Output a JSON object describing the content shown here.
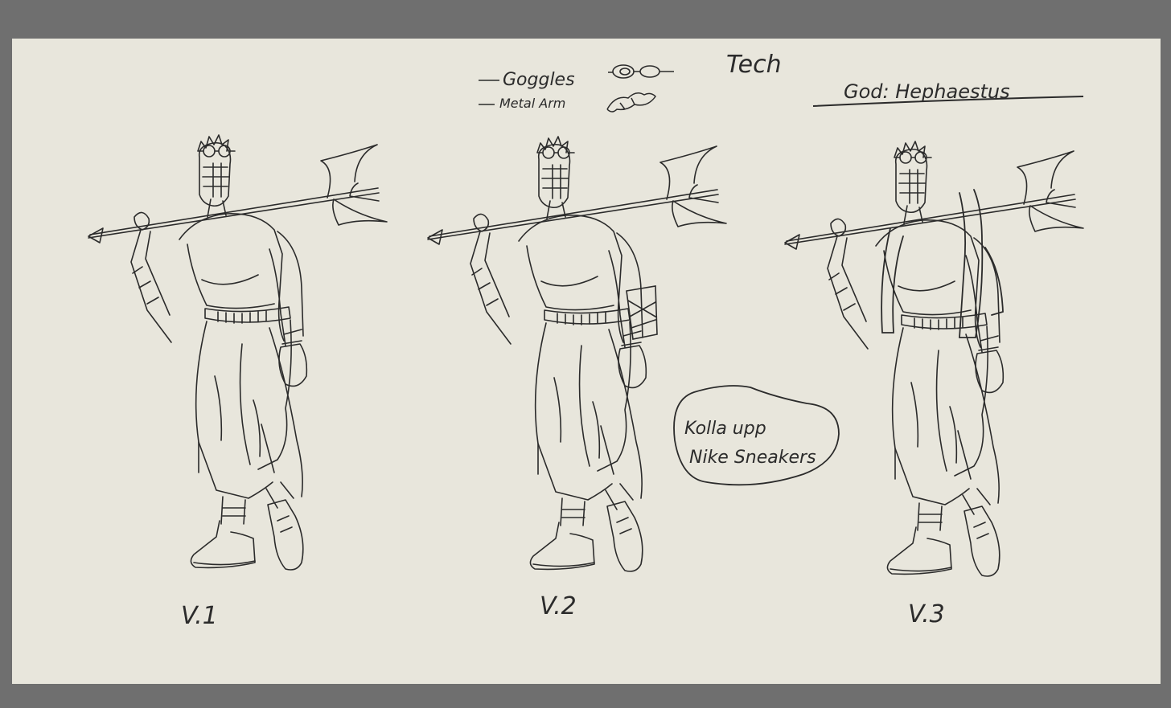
{
  "notes": {
    "goggles": "Goggles",
    "metal_arm": "Metal Arm",
    "tech": "Tech",
    "god": "God: Hephaestus"
  },
  "bubble": {
    "line1": "Kolla upp",
    "line2": "Nike Sneakers"
  },
  "versions": [
    "V.1",
    "V.2",
    "V.3"
  ],
  "colors": {
    "backdrop": "#6f6f6f",
    "paper": "#e8e6dc",
    "ink": "#2b2b2b"
  }
}
